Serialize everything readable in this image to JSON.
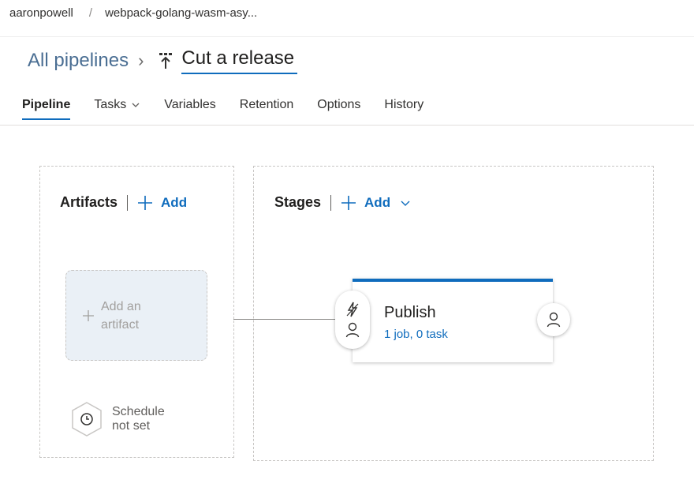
{
  "breadcrumb": {
    "org": "aaronpowell",
    "separator": "/",
    "project": "webpack-golang-wasm-asy..."
  },
  "header": {
    "all_pipelines": "All pipelines",
    "chevron": "›",
    "pipeline_title": "Cut a release"
  },
  "tabs": [
    {
      "label": "Pipeline",
      "active": true
    },
    {
      "label": "Tasks",
      "has_dropdown": true
    },
    {
      "label": "Variables"
    },
    {
      "label": "Retention"
    },
    {
      "label": "Options"
    },
    {
      "label": "History"
    }
  ],
  "artifacts": {
    "heading": "Artifacts",
    "add_label": "Add",
    "placeholder_line1": "Add an",
    "placeholder_line2": "artifact",
    "schedule_line1": "Schedule",
    "schedule_line2": "not set"
  },
  "stages": {
    "heading": "Stages",
    "add_label": "Add",
    "items": [
      {
        "name": "Publish",
        "meta": "1 job, 0 task"
      }
    ]
  },
  "colors": {
    "accent": "#0f6cbd",
    "link_muted": "#4a6e93",
    "placeholder_bg": "#eaf0f6"
  },
  "icons": {
    "pipeline": "release-pipeline-icon",
    "add": "plus-icon",
    "schedule": "clock-hexagon-icon",
    "pre_trigger": "lightning-icon",
    "approver": "person-icon"
  }
}
